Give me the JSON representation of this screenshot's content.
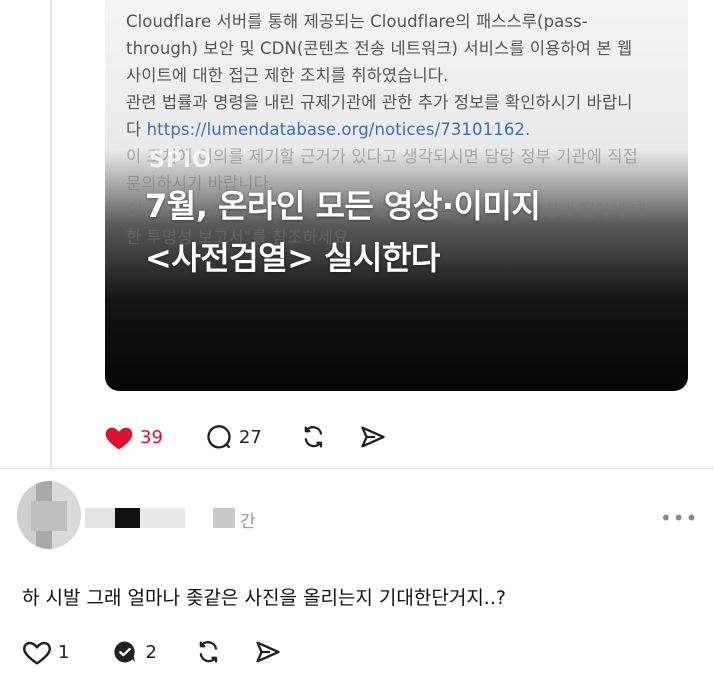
{
  "post": {
    "media": {
      "lines": [
        "Cloudflare 서버를 통해 제공되는 Cloudflare의 패스스루(pass-",
        "through) 보안 및 CDN(콘텐츠 전송 네트워크) 서비스를 이용하여 본 웹",
        "사이트에 대한 접근 제한 조치를 취하였습니다.",
        "관련 법률과 명령을 내린 규제기관에 관한 추가 정보를 확인하시기 바랍니"
      ],
      "link_prefix": "다 ",
      "link": "https://lumendatabase.org/notices/73101162.",
      "faded_lines": [
        "이 조치에 이의를 제기할 근거가 있다고 생각되시면 담당 정부 기관에 직접",
        "문의하시기 바랍니다.",
        "Cloudflare의 차단 정책에 대한 자세한 내용은 여기<>의 \"침해 절차에 대",
        "한 투명성 보고서\"를 참조하세요."
      ],
      "brand": "SPIO",
      "headline_line1": "7월, 온라인 모든 영상·이미지",
      "headline_line2": "<사전검열> 실시한다"
    },
    "actions": {
      "likes": "39",
      "comments": "27"
    }
  },
  "comment": {
    "time_label": "간",
    "text": "하 시발 그래 얼마나 좆같은 사진을 올리는지 기대한단거지..?",
    "likes": "1",
    "replies": "2"
  },
  "colors": {
    "like_red": "#e0102f",
    "link_blue": "#3a6fbf"
  },
  "icons": [
    "heart-icon",
    "comment-icon",
    "repost-icon",
    "share-icon",
    "more-icon"
  ]
}
